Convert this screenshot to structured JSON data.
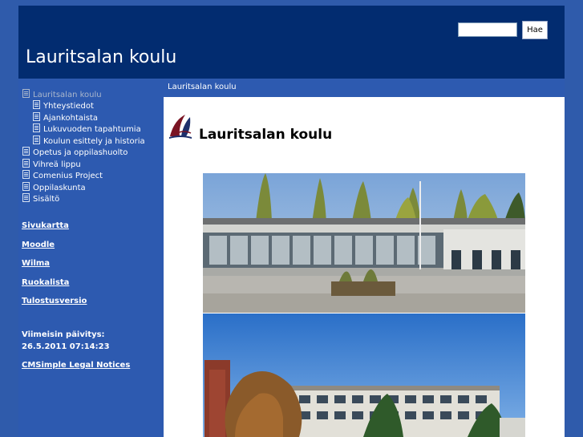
{
  "header": {
    "site_title": "Lauritsalan koulu",
    "search": {
      "value": "",
      "button_label": "Hae"
    }
  },
  "sidebar": {
    "nav": [
      {
        "label": "Lauritsalan koulu",
        "active": true
      },
      {
        "label": "Yhteystiedot"
      },
      {
        "label": "Ajankohtaista"
      },
      {
        "label": "Lukuvuoden tapahtumia"
      },
      {
        "label": "Koulun esittely ja historia"
      },
      {
        "label": "Opetus ja oppilashuolto"
      },
      {
        "label": "Vihreä lippu"
      },
      {
        "label": "Comenius Project"
      },
      {
        "label": "Oppilaskunta"
      },
      {
        "label": "Sisältö"
      }
    ],
    "links": {
      "sitemap": "Sivukartta",
      "moodle": "Moodle",
      "wilma": "Wilma",
      "menu": "Ruokalista",
      "print": "Tulostusversio"
    },
    "last_updated_label": "Viimeisin päivitys:",
    "last_updated_date": "26.5.2011 07:14:23",
    "legal": "CMSimple Legal Notices"
  },
  "breadcrumb": "Lauritsalan koulu",
  "content": {
    "heading": "Lauritsalan koulu"
  },
  "colors": {
    "header_bg": "#022c70",
    "sidebar_bg": "#2d5ab0",
    "page_bg": "#2f5bab"
  },
  "icons": {
    "nav_item": "document-icon",
    "logo": "sailboat-logo"
  }
}
